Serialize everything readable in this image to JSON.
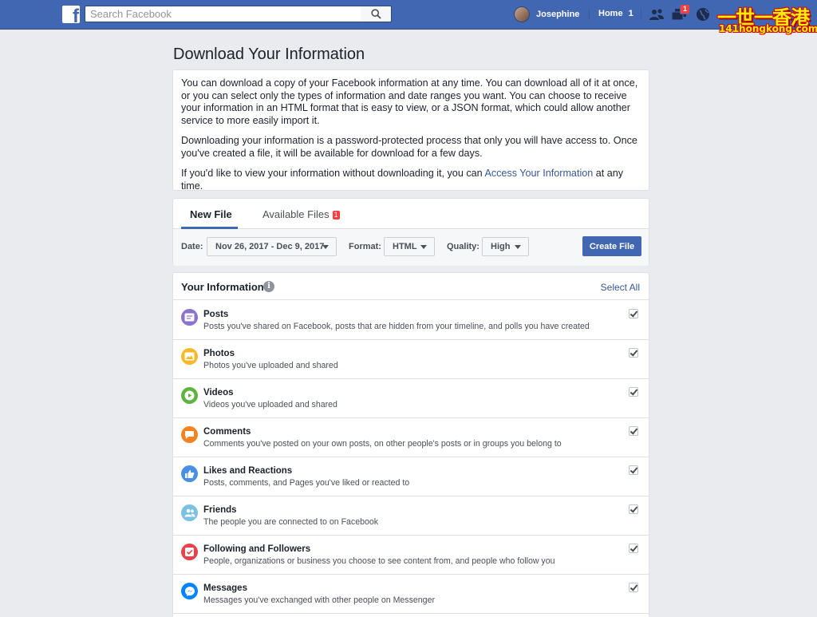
{
  "topbar": {
    "logo": "f",
    "search_placeholder": "Search Facebook",
    "profile_name": "Josephine",
    "home_label": "Home",
    "home_count": "1",
    "notifications_count": "1",
    "watermark_main": "一世一香港",
    "watermark_sub": "141hongkong.com"
  },
  "page": {
    "title": "Download Your Information"
  },
  "intro": {
    "p1": "You can download a copy of your Facebook information at any time. You can download all of it at once, or you can select only the types of information and date ranges you want. You can choose to receive your information in an HTML format that is easy to view, or a JSON format, which could allow another service to more easily import it.",
    "p2": "Downloading your information is a password-protected process that only you will have access to. Once you've created a file, it will be available for download for a few days.",
    "p3_before": "If you'd like to view your information without downloading it, you can ",
    "p3_link": "Access Your Information",
    "p3_after": " at any time."
  },
  "tabs": {
    "new_file": "New File",
    "available_files": "Available Files",
    "available_count": "1"
  },
  "filters": {
    "date_label": "Date:",
    "date_value": "Nov 26, 2017 - Dec 9, 2017",
    "format_label": "Format:",
    "format_value": "HTML",
    "quality_label": "Quality:",
    "quality_value": "High",
    "create_button": "Create File"
  },
  "info": {
    "title": "Your Information",
    "select_all": "Select All",
    "items": [
      {
        "title": "Posts",
        "desc": "Posts you've shared on Facebook, posts that are hidden from your timeline, and polls you have created",
        "icon": "posts-icon",
        "color": "#8c72cb"
      },
      {
        "title": "Photos",
        "desc": "Photos you've uploaded and shared",
        "icon": "photos-icon",
        "color": "#f7b928"
      },
      {
        "title": "Videos",
        "desc": "Videos you've uploaded and shared",
        "icon": "videos-icon",
        "color": "#5fb340"
      },
      {
        "title": "Comments",
        "desc": "Comments you've posted on your own posts, on other people's posts or in groups you belong to",
        "icon": "comments-icon",
        "color": "#f58220"
      },
      {
        "title": "Likes and Reactions",
        "desc": "Posts, comments, and Pages you've liked or reacted to",
        "icon": "likes-icon",
        "color": "#4a90e2"
      },
      {
        "title": "Friends",
        "desc": "The people you are connected to on Facebook",
        "icon": "friends-icon",
        "color": "#7ac1e4"
      },
      {
        "title": "Following and Followers",
        "desc": "People, organizations or business you choose to see content from, and people who follow you",
        "icon": "following-icon",
        "color": "#e9414b"
      },
      {
        "title": "Messages",
        "desc": "Messages you've exchanged with other people on Messenger",
        "icon": "messages-icon",
        "color": "#0084ff"
      }
    ]
  }
}
